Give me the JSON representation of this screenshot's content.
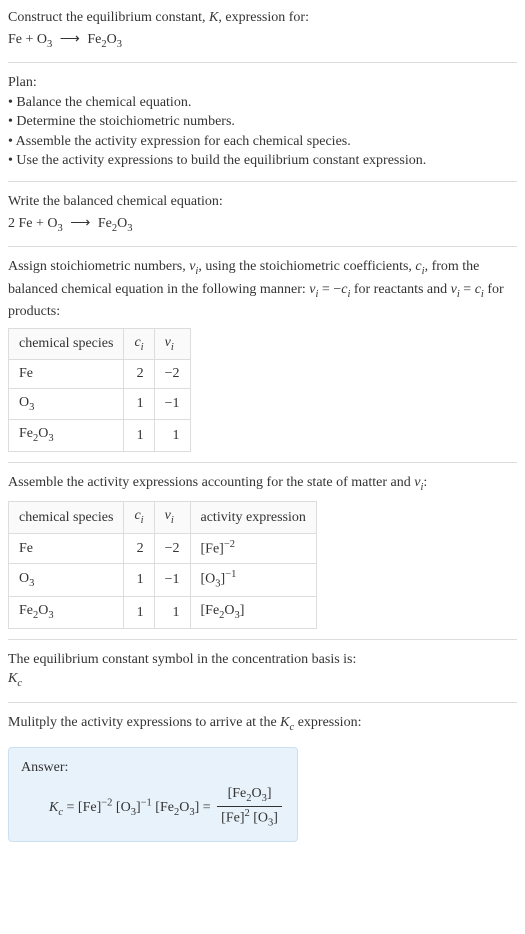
{
  "header": {
    "prompt_line1": "Construct the equilibrium constant, ",
    "prompt_k": "K",
    "prompt_line1b": ", expression for:",
    "eq_reactants": "Fe + O",
    "eq_sub1": "3",
    "arrow": "⟶",
    "eq_product": "Fe",
    "eq_sub2": "2",
    "eq_o": "O",
    "eq_sub3": "3"
  },
  "plan": {
    "title": "Plan:",
    "items": [
      "Balance the chemical equation.",
      "Determine the stoichiometric numbers.",
      "Assemble the activity expression for each chemical species.",
      "Use the activity expressions to build the equilibrium constant expression."
    ]
  },
  "balanced": {
    "title": "Write the balanced chemical equation:",
    "coef1": "2 Fe + O",
    "sub1": "3",
    "arrow": "⟶",
    "prod": "Fe",
    "sub2": "2",
    "o": "O",
    "sub3": "3"
  },
  "assign": {
    "line1a": "Assign stoichiometric numbers, ",
    "nu": "ν",
    "sub_i": "i",
    "line1b": ", using the stoichiometric coefficients, ",
    "c": "c",
    "line1c": ", from the balanced chemical equation in the following manner: ",
    "eq_reactants": " = −",
    "line1d": " for reactants and ",
    "eq_products": " = ",
    "line1e": " for products:",
    "table": {
      "headers": [
        "chemical species",
        "c",
        "ν"
      ],
      "rows": [
        {
          "species_pre": "Fe",
          "species_sub": "",
          "c": "2",
          "nu": "−2"
        },
        {
          "species_pre": "O",
          "species_sub": "3",
          "c": "1",
          "nu": "−1"
        },
        {
          "species_pre": "Fe",
          "species_sub": "2",
          "species_pre2": "O",
          "species_sub2": "3",
          "c": "1",
          "nu": "1"
        }
      ]
    }
  },
  "assemble": {
    "title_a": "Assemble the activity expressions accounting for the state of matter and ",
    "nu": "ν",
    "sub_i": "i",
    "title_b": ":",
    "table": {
      "headers": [
        "chemical species",
        "c",
        "ν",
        "activity expression"
      ],
      "rows": [
        {
          "species_pre": "Fe",
          "species_sub": "",
          "c": "2",
          "nu": "−2",
          "act_pre": "[Fe]",
          "act_sup": "−2"
        },
        {
          "species_pre": "O",
          "species_sub": "3",
          "c": "1",
          "nu": "−1",
          "act_pre": "[O",
          "act_sub": "3",
          "act_close": "]",
          "act_sup": "−1"
        },
        {
          "species_pre": "Fe",
          "species_sub": "2",
          "species_pre2": "O",
          "species_sub2": "3",
          "c": "1",
          "nu": "1",
          "act_pre": "[Fe",
          "act_sub": "2",
          "act_pre2": "O",
          "act_sub2": "3",
          "act_close": "]"
        }
      ]
    }
  },
  "symbol": {
    "line": "The equilibrium constant symbol in the concentration basis is:",
    "k": "K",
    "sub": "c"
  },
  "multiply": {
    "line_a": "Mulitply the activity expressions to arrive at the ",
    "k": "K",
    "sub": "c",
    "line_b": " expression:"
  },
  "answer": {
    "label": "Answer:",
    "k": "K",
    "sub_c": "c",
    "eq": " = [Fe]",
    "sup1": "−2",
    "mid1": " [O",
    "sub_o3": "3",
    "mid1b": "]",
    "sup2": "−1",
    "mid2": " [Fe",
    "sub_fe2": "2",
    "mid2b": "O",
    "sub_o3b": "3",
    "mid2c": "] = ",
    "num_a": "[Fe",
    "num_sub1": "2",
    "num_b": "O",
    "num_sub2": "3",
    "num_c": "]",
    "den_a": "[Fe]",
    "den_sup": "2",
    "den_b": " [O",
    "den_sub": "3",
    "den_c": "]"
  }
}
